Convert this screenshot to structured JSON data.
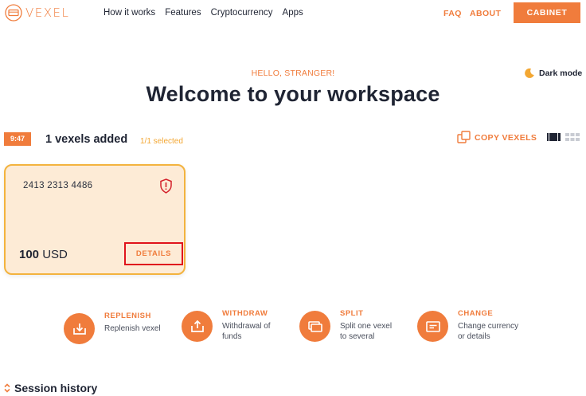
{
  "header": {
    "logo_text": "VEXEL",
    "nav": [
      "How it works",
      "Features",
      "Cryptocurrency",
      "Apps"
    ],
    "faq": "FAQ",
    "about": "ABOUT",
    "cabinet": "CABINET"
  },
  "greeting": {
    "hello": "HELLO, STRANGER!",
    "title": "Welcome to your workspace",
    "dark_mode": "Dark mode"
  },
  "toolbar": {
    "time": "9:47",
    "added": "1 vexels added",
    "selected": "1/1 selected",
    "copy": "COPY VEXELS"
  },
  "card": {
    "number": "2413 2313 4486",
    "amount_value": "100",
    "amount_currency": "USD",
    "details": "DETAILS"
  },
  "actions": [
    {
      "title": "REPLENISH",
      "sub1": "Replenish vexel",
      "sub2": ""
    },
    {
      "title": "WITHDRAW",
      "sub1": "Withdrawal of",
      "sub2": "funds"
    },
    {
      "title": "SPLIT",
      "sub1": "Split one vexel",
      "sub2": "to several"
    },
    {
      "title": "CHANGE",
      "sub1": "Change currency",
      "sub2": "or details"
    }
  ],
  "session": {
    "title": "Session history"
  },
  "colors": {
    "accent": "#f07c3c",
    "card_bg": "#fdebd6",
    "card_border": "#f3b33e",
    "highlight": "#e0141c"
  }
}
